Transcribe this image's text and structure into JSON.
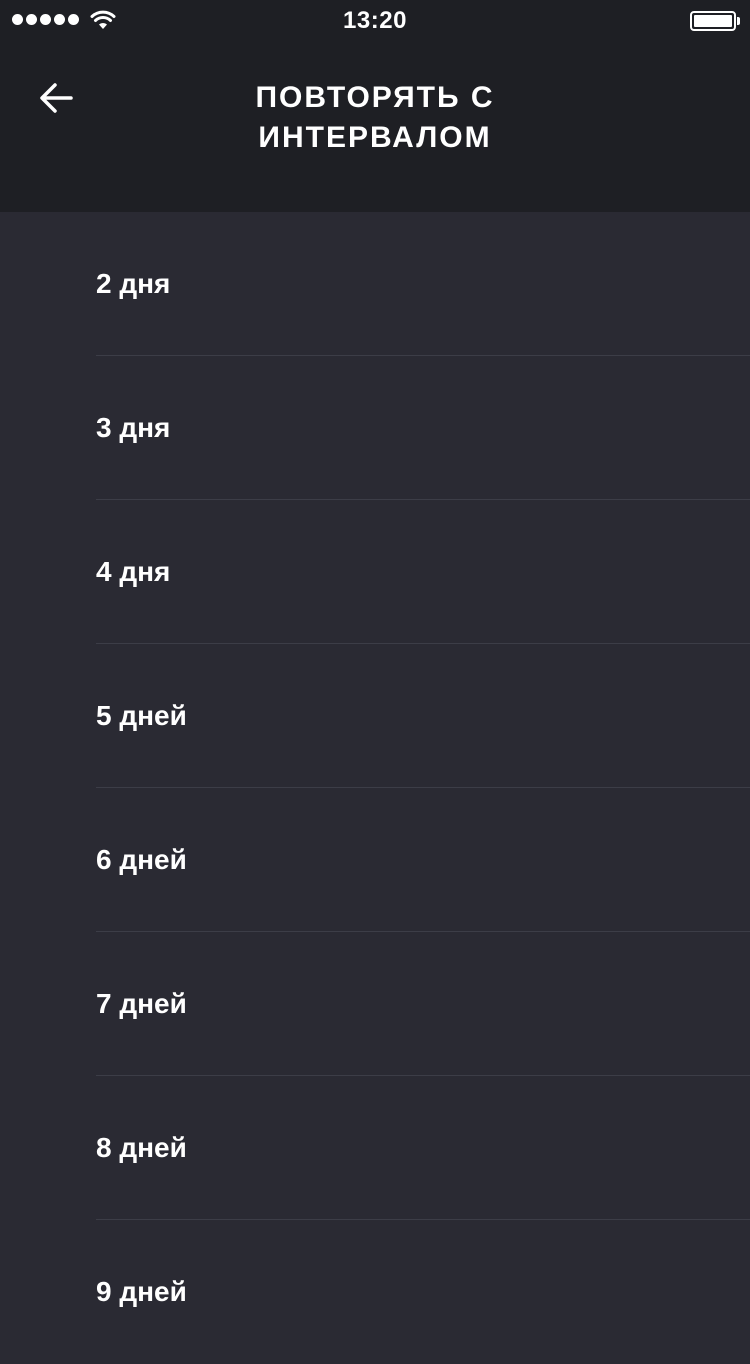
{
  "status_bar": {
    "time": "13:20",
    "signal_icon": "signal-dots-icon",
    "wifi_icon": "wifi-icon",
    "battery_icon": "battery-icon",
    "battery_level": 1.0
  },
  "header": {
    "back_icon": "arrow-left-icon",
    "title_line1": "ПОВТОРЯТЬ С",
    "title_line2": "ИНТЕРВАЛОМ"
  },
  "intervals": [
    {
      "label": "2 дня"
    },
    {
      "label": "3 дня"
    },
    {
      "label": "4 дня"
    },
    {
      "label": "5 дней"
    },
    {
      "label": "6 дней"
    },
    {
      "label": "7 дней"
    },
    {
      "label": "8 дней"
    },
    {
      "label": "9 дней"
    }
  ],
  "colors": {
    "background": "#2a2a33",
    "header_background": "#1e1f24",
    "divider": "#3c3d47",
    "text": "#ffffff"
  }
}
